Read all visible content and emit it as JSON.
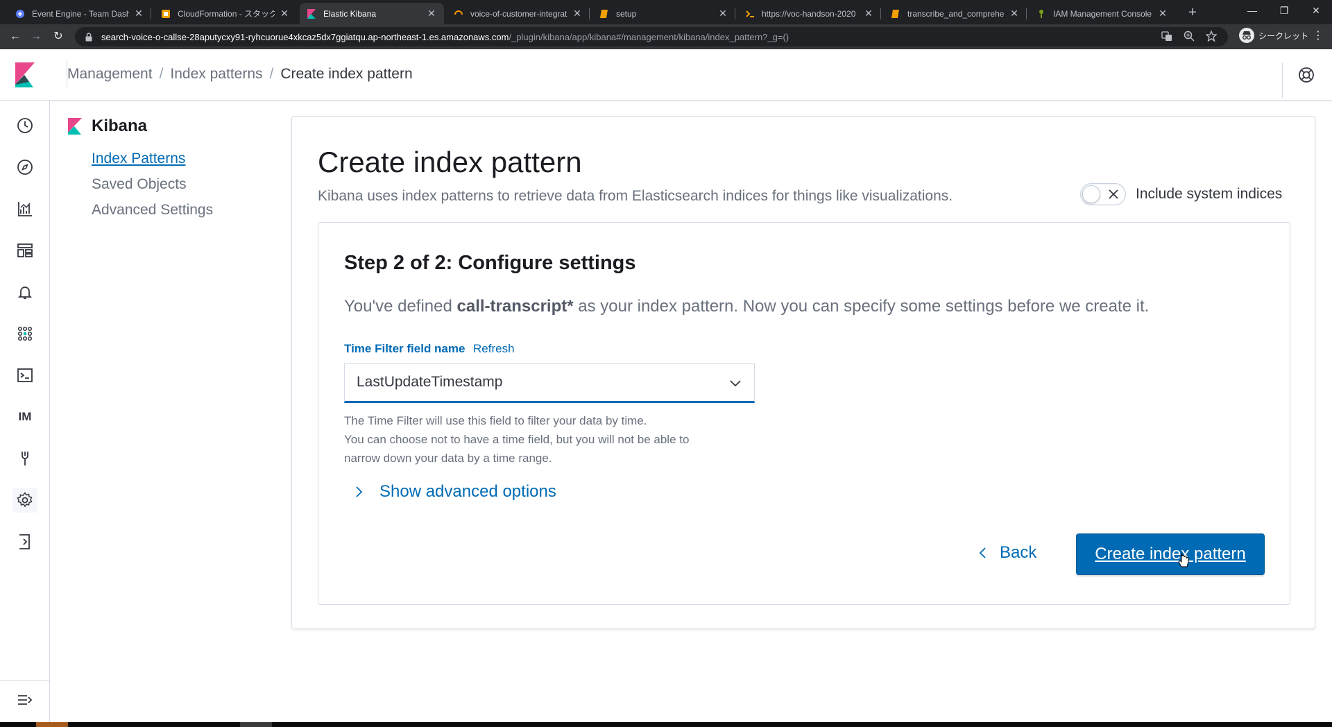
{
  "browser": {
    "tabs": [
      {
        "title": "Event Engine - Team Dashb",
        "active": false
      },
      {
        "title": "CloudFormation - スタック vc",
        "active": false
      },
      {
        "title": "Elastic Kibana",
        "active": true
      },
      {
        "title": "voice-of-customer-integrati",
        "active": false
      },
      {
        "title": "setup",
        "active": false
      },
      {
        "title": "https://voc-handson-2020",
        "active": false
      },
      {
        "title": "transcribe_and_comprehe",
        "active": false
      },
      {
        "title": "IAM Management Console",
        "active": false
      }
    ],
    "new_tab": "+",
    "url_host": "search-voice-o-callse-28aputycxy91-ryhcuorue4xkcaz5dx7ggiatqu.ap-northeast-1.es.amazonaws.com",
    "url_path": "/_plugin/kibana/app/kibana#/management/kibana/index_pattern?_g=()",
    "profile_label": "シークレット"
  },
  "header": {
    "breadcrumbs": [
      {
        "label": "Management",
        "current": false
      },
      {
        "label": "Index patterns",
        "current": false
      },
      {
        "label": "Create index pattern",
        "current": true
      }
    ],
    "separator": "/"
  },
  "rail": {
    "items": [
      "clock-icon",
      "compass-icon",
      "visualize-icon",
      "dashboard-icon",
      "bell-icon",
      "apps-icon",
      "console-icon",
      "IM",
      "wrench-icon",
      "gear-icon",
      "logout-icon"
    ],
    "im_label": "IM"
  },
  "sidebar": {
    "title": "Kibana",
    "links": [
      {
        "label": "Index Patterns",
        "selected": true
      },
      {
        "label": "Saved Objects",
        "selected": false
      },
      {
        "label": "Advanced Settings",
        "selected": false
      }
    ]
  },
  "main": {
    "title": "Create index pattern",
    "subtitle": "Kibana uses index patterns to retrieve data from Elasticsearch indices for things like visualizations.",
    "include_system_label": "Include system indices",
    "include_system_on": false,
    "step": {
      "title": "Step 2 of 2: Configure settings",
      "desc_prefix": "You've defined ",
      "pattern": "call-transcript*",
      "desc_suffix": " as your index pattern. Now you can specify some settings before we create it.",
      "field_label": "Time Filter field name",
      "refresh_label": "Refresh",
      "selected_field": "LastUpdateTimestamp",
      "help_lines": [
        "The Time Filter will use this field to filter your data by time.",
        "You can choose not to have a time field, but you will not be able to",
        "narrow down your data by a time range."
      ],
      "advanced_label": "Show advanced options",
      "back_label": "Back",
      "create_label": "Create index pattern"
    }
  },
  "colors": {
    "primary": "#006bb4",
    "text": "#343741",
    "subdued": "#69707d",
    "border": "#d3dae6"
  }
}
